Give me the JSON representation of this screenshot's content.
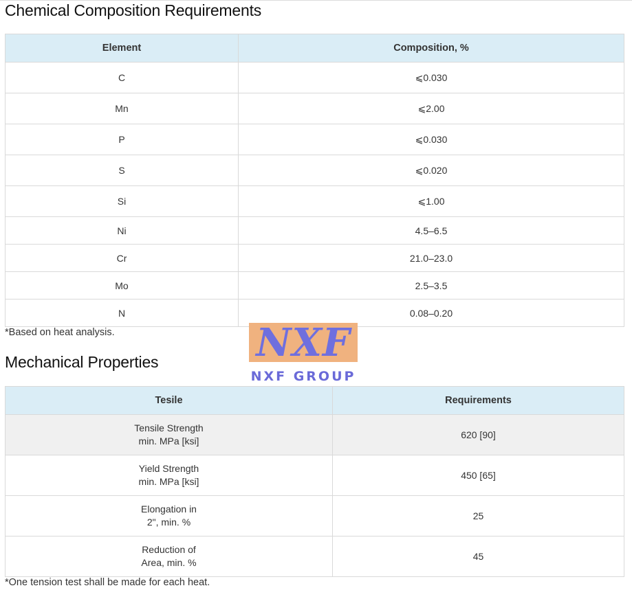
{
  "chemical": {
    "title": "Chemical Composition Requirements",
    "headers": [
      "Element",
      "Composition, %"
    ],
    "rows": [
      [
        "C",
        "⩽0.030"
      ],
      [
        "Mn",
        "⩽2.00"
      ],
      [
        "P",
        "⩽0.030"
      ],
      [
        "S",
        "⩽0.020"
      ],
      [
        "Si",
        "⩽1.00"
      ],
      [
        "Ni",
        "4.5–6.5"
      ],
      [
        "Cr",
        "21.0–23.0"
      ],
      [
        "Mo",
        "2.5–3.5"
      ],
      [
        "N",
        "0.08–0.20"
      ]
    ],
    "note": "*Based on heat analysis."
  },
  "logo": {
    "mark": "NXF",
    "subtitle": "NXF GROUP",
    "colors": {
      "background": "#f0b27f",
      "text": "#6f6fde"
    }
  },
  "mechanical": {
    "title": "Mechanical Properties",
    "headers": [
      "Tesile",
      "Requirements"
    ],
    "rows": [
      {
        "line1": "Tensile Strength",
        "line2": "min. MPa [ksi]",
        "value": "620 [90]"
      },
      {
        "line1": "Yield Strength",
        "line2": "min. MPa [ksi]",
        "value": "450 [65]"
      },
      {
        "line1": "Elongation in",
        "line2": "2\", min. %",
        "value": "25"
      },
      {
        "line1": "Reduction of",
        "line2": "Area, min. %",
        "value": "45"
      }
    ],
    "note": "*One tension test shall be made for each heat."
  },
  "colors": {
    "header_bg": "#daedf6",
    "border": "#d9d9d9",
    "shaded_row": "#f0f0f0"
  }
}
